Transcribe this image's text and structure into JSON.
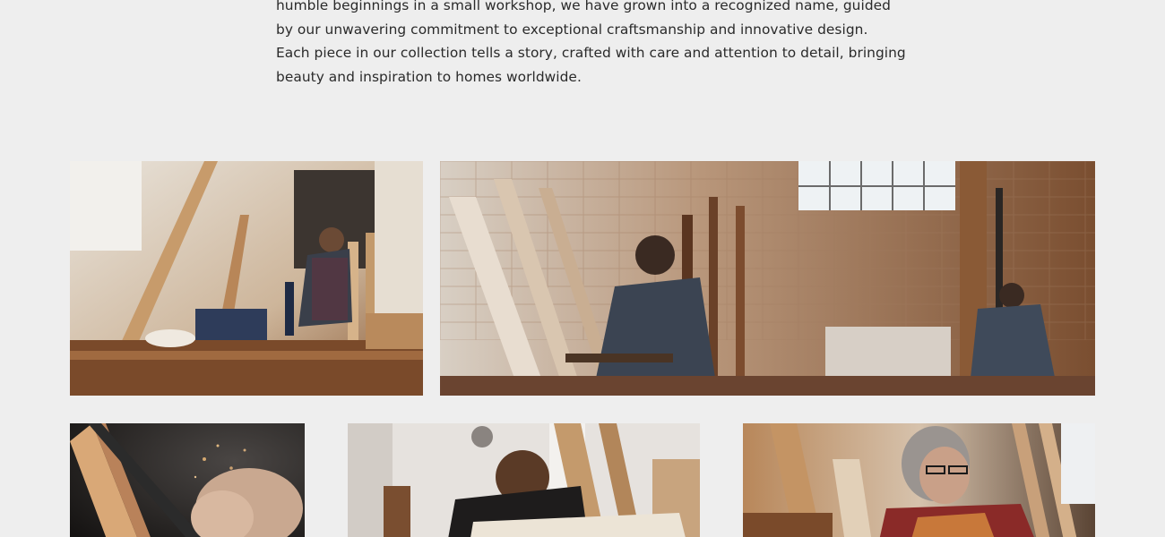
{
  "about": {
    "lines": [
      "humble beginnings in a small workshop, we have grown into a recognized name, guided",
      "by our unwavering commitment to exceptional craftsmanship and innovative design.",
      "Each piece in our collection tells a story, crafted with care and attention to detail, bringing",
      "beauty and inspiration to homes worldwide."
    ]
  },
  "gallery": {
    "images": [
      {
        "subject": "woman drilling wood in bright workshop"
      },
      {
        "subject": "two craftsmen working in rustic brick workshop"
      },
      {
        "subject": "close-up of hands carving wood on lathe"
      },
      {
        "subject": "man with glasses sanding wooden chair"
      },
      {
        "subject": "older craftsman with glasses in plaid shirt"
      }
    ]
  },
  "colors": {
    "page_background": "#eeeeee",
    "text": "#2a2a2a",
    "wood_light": "#c89a6a",
    "wood_dark": "#5a3a22"
  }
}
